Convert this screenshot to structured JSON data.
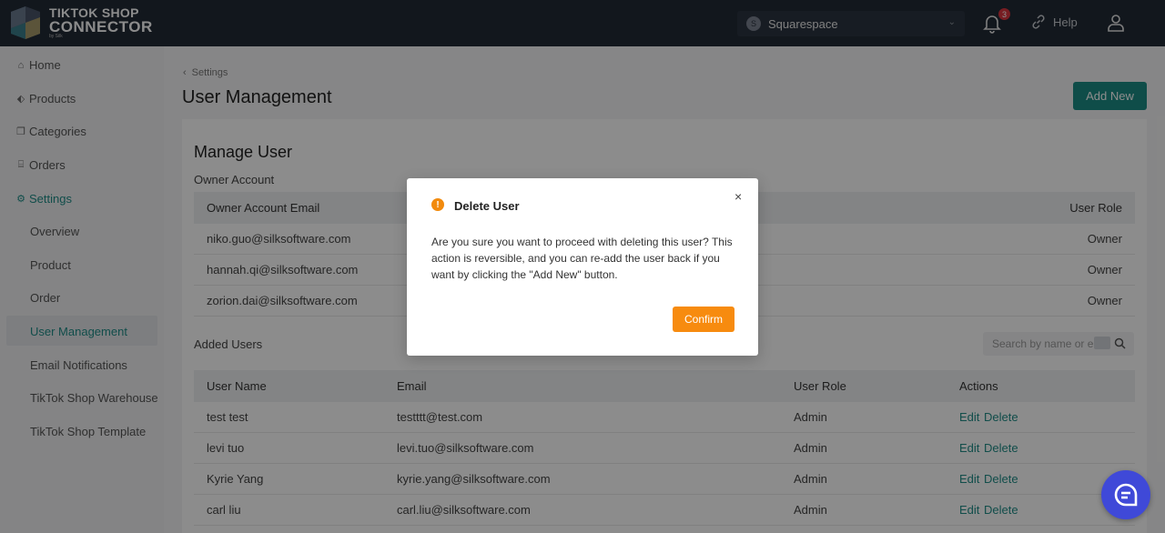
{
  "brand": {
    "line1": "TIKTOK SHOP",
    "line2": "CONNECTOR",
    "line3": "by Silk"
  },
  "topbar": {
    "store_initial": "S",
    "store_name": "Squarespace",
    "notification_count": "3",
    "help_label": "Help"
  },
  "sidebar": {
    "items": [
      {
        "label": "Home",
        "icon": "home-icon"
      },
      {
        "label": "Products",
        "icon": "tag-icon"
      },
      {
        "label": "Categories",
        "icon": "copy-icon"
      },
      {
        "label": "Orders",
        "icon": "inbox-icon"
      },
      {
        "label": "Settings",
        "icon": "gear-icon"
      }
    ],
    "sub_items": [
      {
        "label": "Overview"
      },
      {
        "label": "Product"
      },
      {
        "label": "Order"
      },
      {
        "label": "User Management"
      },
      {
        "label": "Email Notifications"
      },
      {
        "label": "TikTok Shop Warehouse"
      },
      {
        "label": "TikTok Shop Template"
      }
    ]
  },
  "main": {
    "breadcrumb": "Settings",
    "title": "User Management",
    "add_new": "Add New",
    "card_title": "Manage User",
    "owner_label": "Owner Account",
    "owner_table": {
      "headers": [
        "Owner Account Email",
        "User Role"
      ],
      "rows": [
        {
          "email": "niko.guo@silksoftware.com",
          "role": "Owner"
        },
        {
          "email": "hannah.qi@silksoftware.com",
          "role": "Owner"
        },
        {
          "email": "zorion.dai@silksoftware.com",
          "role": "Owner"
        }
      ]
    },
    "added_label": "Added Users",
    "search_placeholder": "Search by name or em",
    "users_table": {
      "headers": [
        "User Name",
        "Email",
        "User Role",
        "Actions"
      ],
      "edit_label": "Edit",
      "delete_label": "Delete",
      "rows": [
        {
          "name": "test test",
          "email": "testttt@test.com",
          "role": "Admin"
        },
        {
          "name": "levi tuo",
          "email": "levi.tuo@silksoftware.com",
          "role": "Admin"
        },
        {
          "name": "Kyrie Yang",
          "email": "kyrie.yang@silksoftware.com",
          "role": "Admin"
        },
        {
          "name": "carl liu",
          "email": "carl.liu@silksoftware.com",
          "role": "Admin"
        }
      ]
    }
  },
  "modal": {
    "title": "Delete User",
    "body": "Are you sure you want to proceed with deleting this user? This action is reversible, and you can re-add the user back if you want by clicking the \"Add New\" button.",
    "confirm": "Confirm",
    "close_glyph": "×",
    "warn_glyph": "!"
  },
  "colors": {
    "accent": "#1c8d86",
    "topbar": "#212a36",
    "warning": "#f78b0f",
    "chat": "#3f49d8"
  }
}
